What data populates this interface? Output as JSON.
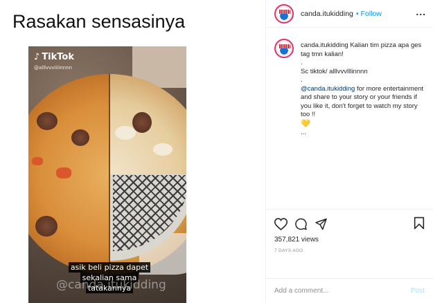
{
  "post": {
    "caption_title": "Rasakan sensasinya",
    "video": {
      "brand": "TikTok",
      "tiktok_user": "@alllvvviiiinnnn",
      "subtitle_lines": [
        "asik beli pizza dapet",
        "sekalian sama",
        "tatakannya"
      ],
      "watermark": "@canda.itukidding"
    }
  },
  "header": {
    "username": "canda.itukidding",
    "follow_label": "Follow",
    "separator": "•",
    "more_icon": "more-horizontal-icon"
  },
  "comment": {
    "username": "canda.itukidding",
    "line1": "Kalian tim pizza apa ges tag tmn kalian!",
    "dot1": ".",
    "source": "Sc tiktok/ alllvvvlllinnnn",
    "dot2": ".",
    "mention": "@canda.itukidding",
    "promo": " for more entertainment and share to your story or your friends if you like it, don't forget to watch my story too !!",
    "heart": "💛",
    "ellipsis": "..."
  },
  "actions": {
    "icons": [
      "heart-icon",
      "comment-icon",
      "share-icon",
      "bookmark-icon"
    ],
    "views": "357,821 views",
    "time_ago": "7 DAYS AGO"
  },
  "add_comment": {
    "placeholder": "Add a comment...",
    "post_label": "Post"
  },
  "colors": {
    "link": "#0095f6",
    "mention": "#00376b",
    "post_disabled": "#b2dffc",
    "muted": "#8e8e8e"
  }
}
